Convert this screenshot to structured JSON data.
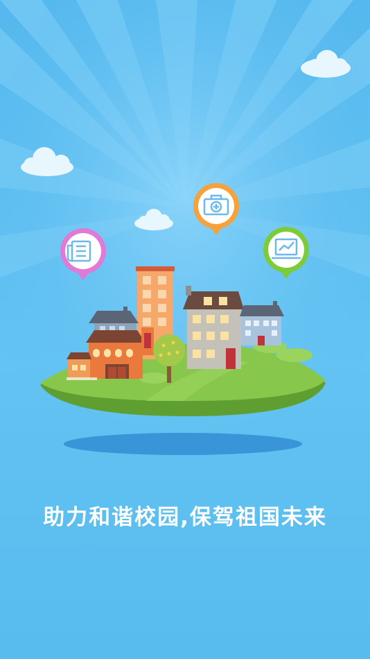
{
  "splash": {
    "slogan": "助力和谐校园,保驾祖国未来"
  },
  "icons": {
    "left_pin": "news-icon",
    "center_pin": "medical-kit-icon",
    "right_pin": "laptop-chart-icon"
  },
  "colors": {
    "sky": "#5bbdf0",
    "pin_pink": "#e07ad6",
    "pin_orange": "#f6a23a",
    "pin_green": "#7ccc3a",
    "island_grass": "#82c34a",
    "slogan_text": "#ffffff"
  }
}
